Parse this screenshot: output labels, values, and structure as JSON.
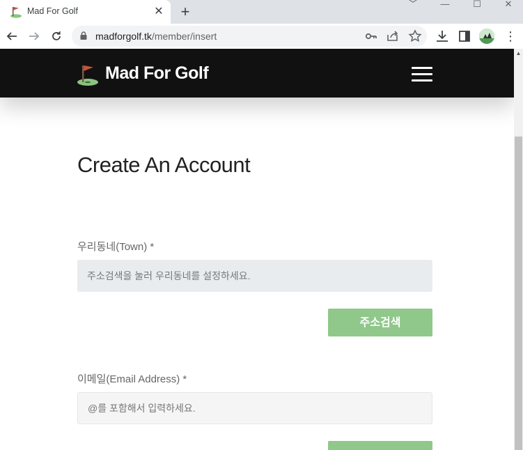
{
  "browser": {
    "tab_title": "Mad For Golf",
    "tab_close": "✕",
    "new_tab": "+",
    "url_host": "madforgolf.tk",
    "url_path": "/member/insert",
    "window_controls": [
      "﹀",
      "—",
      "☐",
      "✕"
    ],
    "menu": "⋮"
  },
  "site": {
    "logo_text": "Mad For Golf"
  },
  "page": {
    "title": "Create An Account",
    "town_label": "우리동네(Town) *",
    "town_placeholder": "주소검색을 눌러 우리동네를 설정하세요.",
    "address_search_button": "주소검색",
    "email_label": "이메일(Email Address) *",
    "email_placeholder": "@를 포함해서 입력하세요."
  },
  "colors": {
    "header_bg": "#111111",
    "button_green": "#8fc88a",
    "flag_red": "#c8523c",
    "green": "#8bc47f"
  }
}
